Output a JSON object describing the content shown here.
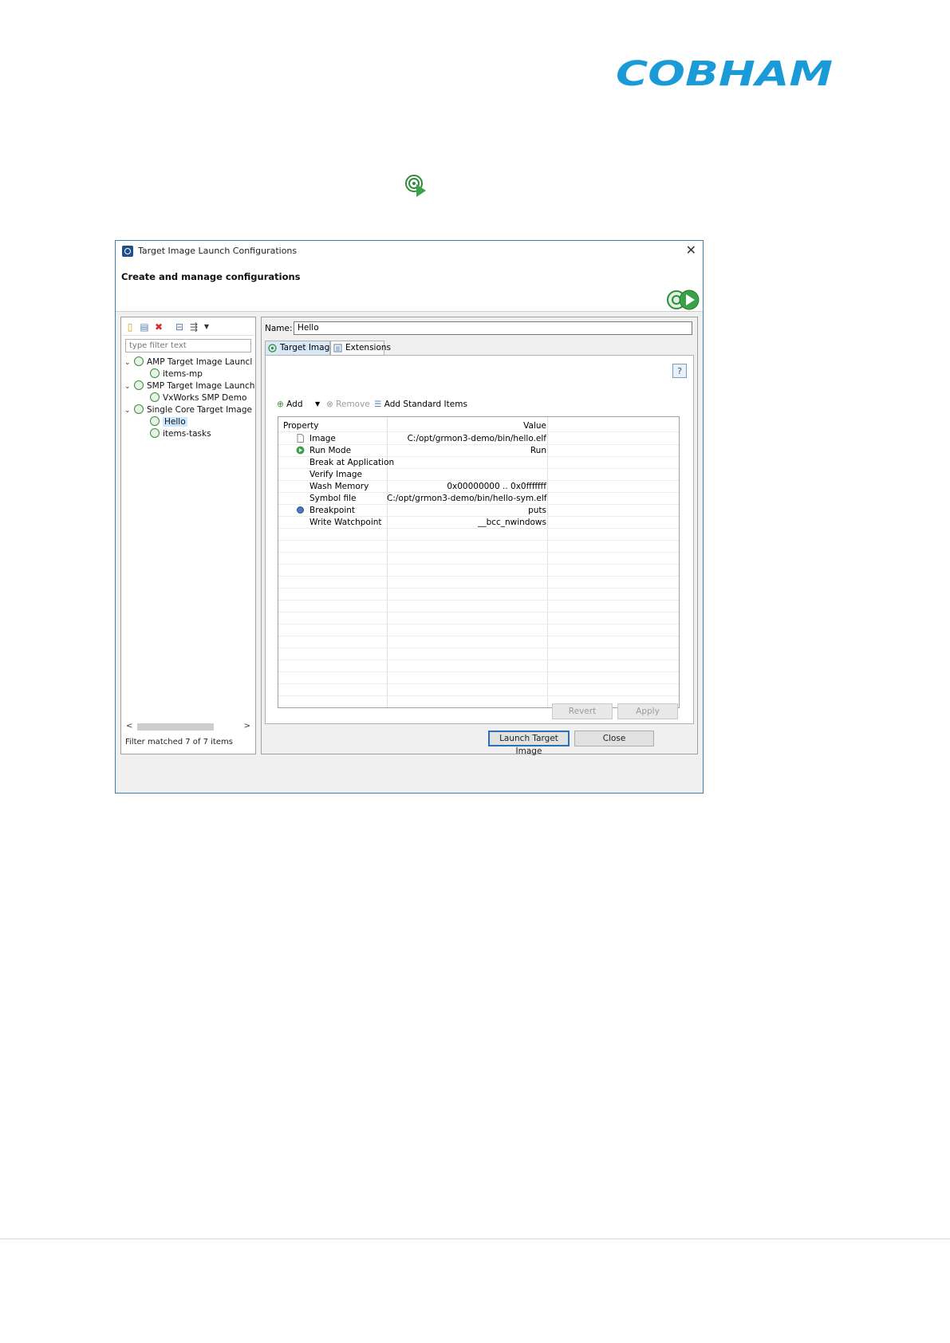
{
  "brand": {
    "logo_text": "COBHAM",
    "color": "#1a9ad6"
  },
  "window": {
    "title": "Target Image Launch Configurations",
    "close_glyph": "✕"
  },
  "header": {
    "subtitle": "Create and manage configurations"
  },
  "left": {
    "filter_placeholder": "type filter text",
    "tree": [
      {
        "label": "AMP Target Image Launcl",
        "level": 0,
        "expanded": true
      },
      {
        "label": "items-mp",
        "level": 1
      },
      {
        "label": "SMP Target Image Launch",
        "level": 0,
        "expanded": true
      },
      {
        "label": "VxWorks SMP Demo",
        "level": 1
      },
      {
        "label": "Single Core Target Image",
        "level": 0,
        "expanded": true
      },
      {
        "label": "Hello",
        "level": 1,
        "selected": true
      },
      {
        "label": "items-tasks",
        "level": 1
      }
    ],
    "status": "Filter matched 7 of 7 items"
  },
  "right": {
    "name_label": "Name:",
    "name_value": "Hello",
    "tabs": [
      {
        "label": "Target Image",
        "active": true
      },
      {
        "label": "Extensions"
      }
    ],
    "help": "?",
    "actions": {
      "add": "Add",
      "remove": "Remove",
      "add_standard": "Add Standard Items"
    },
    "grid": {
      "headers": {
        "property": "Property",
        "value": "Value"
      },
      "rows": [
        {
          "property": "Image",
          "value": "C:/opt/grmon3-demo/bin/hello.elf",
          "icon": "file-icon"
        },
        {
          "property": "Run Mode",
          "value": "Run",
          "icon": "run-icon"
        },
        {
          "property": "Break at Application",
          "value": ""
        },
        {
          "property": "Verify Image",
          "value": ""
        },
        {
          "property": "Wash Memory",
          "value": "0x00000000 .. 0x0fffffff"
        },
        {
          "property": "Symbol file",
          "value": "C:/opt/grmon3-demo/bin/hello-sym.elf"
        },
        {
          "property": "Breakpoint",
          "value": "puts",
          "icon": "breakpoint-icon"
        },
        {
          "property": "Write Watchpoint",
          "value": "__bcc_nwindows"
        }
      ]
    },
    "revert": "Revert",
    "apply": "Apply"
  },
  "footer": {
    "launch": "Launch Target Image",
    "close": "Close"
  }
}
